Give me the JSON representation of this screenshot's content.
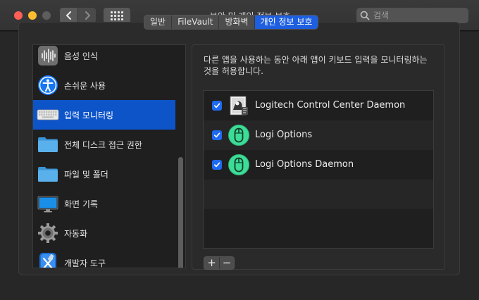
{
  "window": {
    "title": "보안 및 개인 정보 보호"
  },
  "search": {
    "placeholder": "검색"
  },
  "tabs": [
    {
      "label": "일반",
      "active": false
    },
    {
      "label": "FileVault",
      "active": false
    },
    {
      "label": "방화벽",
      "active": false
    },
    {
      "label": "개인 정보 보호",
      "active": true
    }
  ],
  "sidebar": {
    "items": [
      {
        "label": "음성 인식",
        "icon": "waveform-icon",
        "selected": false
      },
      {
        "label": "손쉬운 사용",
        "icon": "accessibility-icon",
        "selected": false
      },
      {
        "label": "입력 모니터링",
        "icon": "keyboard-icon",
        "selected": true
      },
      {
        "label": "전체 디스크 접근 권한",
        "icon": "folder-icon",
        "selected": false
      },
      {
        "label": "파일 및 폴더",
        "icon": "folder-icon",
        "selected": false
      },
      {
        "label": "화면 기록",
        "icon": "display-icon",
        "selected": false
      },
      {
        "label": "자동화",
        "icon": "gear-icon",
        "selected": false
      },
      {
        "label": "개발자 도구",
        "icon": "developer-tools-icon",
        "selected": false
      }
    ]
  },
  "detail": {
    "description": "다른 앱을 사용하는 동안 아래 앱이 키보드 입력을 모니터링하는 것을 허용합니다.",
    "apps": [
      {
        "name": "Logitech Control Center Daemon",
        "checked": true,
        "icon": "logitech-daemon-icon"
      },
      {
        "name": "Logi Options",
        "checked": true,
        "icon": "logi-mouse-icon"
      },
      {
        "name": "Logi Options Daemon",
        "checked": true,
        "icon": "logi-mouse-icon"
      }
    ],
    "add_label": "+",
    "remove_label": "−"
  },
  "colors": {
    "accent": "#1d5fe0",
    "selection": "#0d54c9",
    "checkbox": "#1e6af3",
    "logi_green": "#3ddc97"
  }
}
